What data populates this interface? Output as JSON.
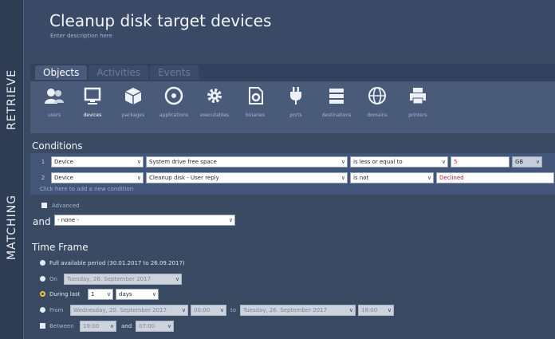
{
  "sidebar": {
    "retrieve": "RETRIEVE",
    "matching": "MATCHING"
  },
  "header": {
    "title": "Cleanup disk target devices",
    "subtitle": "Enter description here"
  },
  "tabs": [
    {
      "label": "Objects",
      "active": true
    },
    {
      "label": "Activities",
      "active": false
    },
    {
      "label": "Events",
      "active": false
    }
  ],
  "objects": [
    {
      "label": "users",
      "icon": "users-icon"
    },
    {
      "label": "devices",
      "icon": "monitor-icon",
      "selected": true
    },
    {
      "label": "packages",
      "icon": "package-icon"
    },
    {
      "label": "applications",
      "icon": "disc-icon"
    },
    {
      "label": "executables",
      "icon": "gear-icon"
    },
    {
      "label": "binaries",
      "icon": "binary-gear-icon"
    },
    {
      "label": "ports",
      "icon": "plug-icon"
    },
    {
      "label": "destinations",
      "icon": "server-icon"
    },
    {
      "label": "domains",
      "icon": "globe-icon"
    },
    {
      "label": "printers",
      "icon": "printer-icon"
    }
  ],
  "conditions": {
    "title": "Conditions",
    "rows": [
      {
        "num": "1",
        "scope": "Device",
        "field": "System drive free space",
        "op": "is less or equal to",
        "value": "5",
        "unit": "GB"
      },
      {
        "num": "2",
        "scope": "Device",
        "field": "Cleanup disk - User reply",
        "op": "is not",
        "value": "Declined"
      }
    ],
    "add_link": "Click here to add a new condition",
    "advanced": "Advanced",
    "and_label": "and",
    "and_value": "- none -"
  },
  "timeframe": {
    "title": "Time Frame",
    "full_period": "Full available period (30.01.2017 to 26.09.2017)",
    "on_label": "On",
    "on_date": "Tuesday, 26. September 2017",
    "during_label": "During last",
    "during_value": "1",
    "during_unit": "days",
    "from_label": "From",
    "from_date": "Wednesday, 20. September 2017",
    "from_time": "00:00",
    "to_label": "to",
    "to_date": "Tuesday, 26. September 2017",
    "to_time": "18:00",
    "between_label": "Between",
    "between_start": "19:00",
    "between_and": "and",
    "between_end": "07:00"
  },
  "colors": {
    "accent_ring": "#f0c040",
    "panel": "#44557a",
    "background": "#3a4a63"
  }
}
